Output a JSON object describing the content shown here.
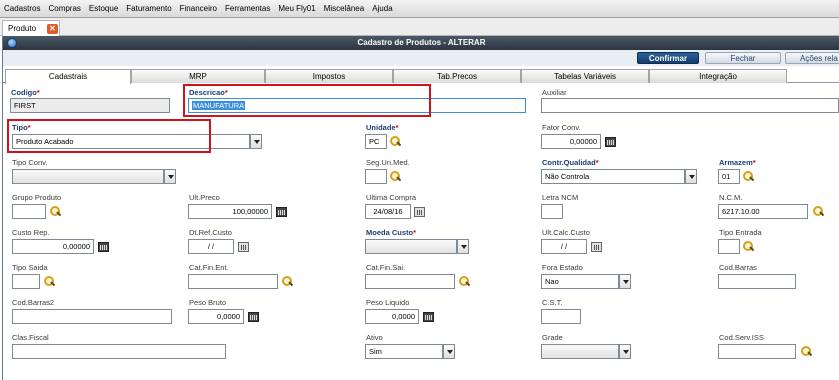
{
  "menu": [
    "Cadastros",
    "Compras",
    "Estoque",
    "Faturamento",
    "Financeiro",
    "Ferramentas",
    "Meu Fly01",
    "Miscelânea",
    "Ajuda"
  ],
  "doc_tab": {
    "label": "Produto",
    "close": "✕"
  },
  "window": {
    "title": "Cadastro de Produtos - ALTERAR"
  },
  "toolbar": {
    "confirm": "Confirmar",
    "close": "Fechar",
    "actions": "Ações rela"
  },
  "folders": [
    "Cadastrais",
    "MRP",
    "Impostos",
    "Tab.Precos",
    "Tabelas Variáveis",
    "Integração"
  ],
  "fields": {
    "codigo": {
      "label": "Codigo",
      "value": "FIRST"
    },
    "descricao": {
      "label": "Descricao",
      "value": "MANUFATURA"
    },
    "auxiliar": {
      "label": "Auxiliar",
      "value": ""
    },
    "tipo": {
      "label": "Tipo",
      "value": "Produto Acabado"
    },
    "unidade": {
      "label": "Unidade",
      "value": "PC"
    },
    "fator_conv": {
      "label": "Fator Conv.",
      "value": "0,00000"
    },
    "tipo_conv": {
      "label": "Tipo Conv.",
      "value": ""
    },
    "seg_un_med": {
      "label": "Seg.Un.Med.",
      "value": ""
    },
    "contr_qualidad": {
      "label": "Contr.Qualidad",
      "value": "Não Controla"
    },
    "armazem": {
      "label": "Armazem",
      "value": "01"
    },
    "grupo_produto": {
      "label": "Grupo Produto",
      "value": ""
    },
    "ult_preco": {
      "label": "Ult.Preco",
      "value": "100,00000"
    },
    "ultima_compra": {
      "label": "Ultima Compra",
      "value": "24/08/16"
    },
    "letra_ncm": {
      "label": "Letra NCM",
      "value": ""
    },
    "ncm": {
      "label": "N.C.M.",
      "value": "6217.10.00"
    },
    "custo_rep": {
      "label": "Custo Rep.",
      "value": "0,00000"
    },
    "dt_ref_custo": {
      "label": "Dt.Ref.Custo",
      "value": "/ /"
    },
    "moeda_custo": {
      "label": "Moeda Custo",
      "value": ""
    },
    "ult_calc_custo": {
      "label": "Ult.Calc.Custo",
      "value": "/ /"
    },
    "tipo_entrada": {
      "label": "Tipo Entrada",
      "value": ""
    },
    "tipo_saida": {
      "label": "Tipo Saida",
      "value": ""
    },
    "cat_fin_ent": {
      "label": "Cat.Fin.Ent.",
      "value": ""
    },
    "cat_fin_sai": {
      "label": "Cat.Fin.Sai.",
      "value": ""
    },
    "fora_estado": {
      "label": "Fora Estado",
      "value": "Nao"
    },
    "cod_barras": {
      "label": "Cod.Barras",
      "value": ""
    },
    "cod_barras2": {
      "label": "Cod.Barras2",
      "value": ""
    },
    "peso_bruto": {
      "label": "Peso Bruto",
      "value": "0,0000"
    },
    "peso_liquido": {
      "label": "Peso Liquido",
      "value": "0,0000"
    },
    "cst": {
      "label": "C.S.T.",
      "value": ""
    },
    "clas_fiscal": {
      "label": "Clas.Fiscal",
      "value": ""
    },
    "ativo": {
      "label": "Ativo",
      "value": "Sim"
    },
    "grade": {
      "label": "Grade",
      "value": ""
    },
    "cod_serv_iss": {
      "label": "Cod.Serv.ISS",
      "value": ""
    }
  },
  "required_star": "*",
  "colors": {
    "highlight": "#d0121a",
    "title_bg": "#2c3540",
    "confirm_bg": "#1e4f84"
  }
}
